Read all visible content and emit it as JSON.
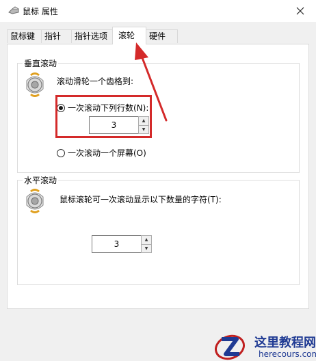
{
  "window": {
    "title": "鼠标 属性",
    "close_label": "✕"
  },
  "tabs": [
    {
      "label": "鼠标键",
      "active": false
    },
    {
      "label": "指针",
      "active": false
    },
    {
      "label": "指针选项",
      "active": false
    },
    {
      "label": "滚轮",
      "active": true
    },
    {
      "label": "硬件",
      "active": false
    }
  ],
  "vertical_scroll": {
    "group_title": "垂直滚动",
    "description": "滚动滑轮一个齿格到:",
    "option_lines_label": "一次滚动下列行数(N):",
    "option_lines_checked": true,
    "lines_value": "3",
    "option_screen_label": "一次滚动一个屏幕(O)",
    "option_screen_checked": false
  },
  "horizontal_scroll": {
    "group_title": "水平滚动",
    "description": "鼠标滚轮可一次滚动显示以下数量的字符(T):",
    "chars_value": "3"
  },
  "annotation": {
    "highlight_color": "#d42a2a"
  },
  "watermark": {
    "cn_text": "这里教程网",
    "en_text": "herecours.com"
  }
}
